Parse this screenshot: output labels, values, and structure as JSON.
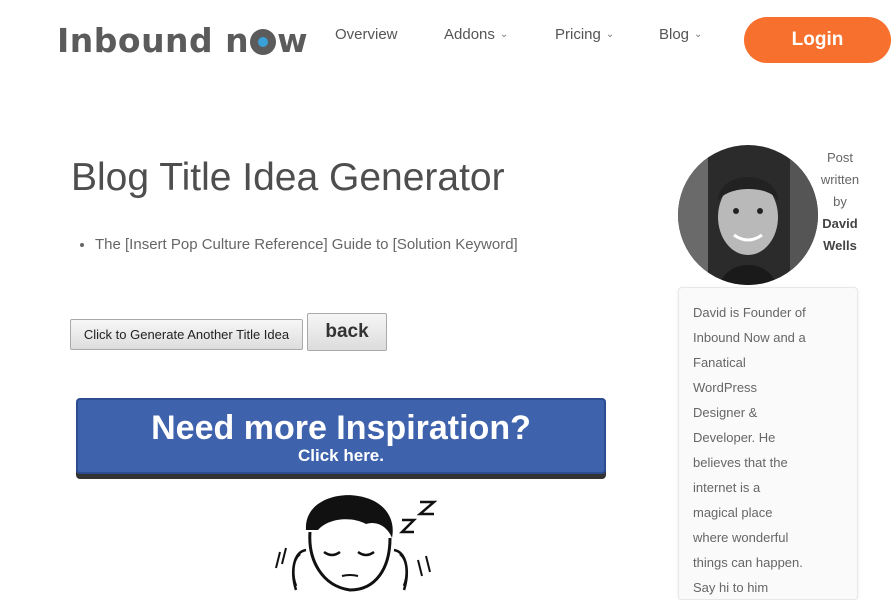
{
  "header": {
    "logo_left": "Inbound n",
    "logo_right": "w",
    "nav": [
      {
        "label": "Overview",
        "has_dropdown": false
      },
      {
        "label": "Addons",
        "has_dropdown": true
      },
      {
        "label": "Pricing",
        "has_dropdown": true
      },
      {
        "label": "Blog",
        "has_dropdown": true
      }
    ],
    "login_label": "Login",
    "accent_color": "#f7702e"
  },
  "main": {
    "title": "Blog Title Idea Generator",
    "ideas": [
      "The [Insert Pop Culture Reference] Guide to [Solution Keyword]"
    ],
    "generate_label": "Click to Generate Another Title Idea",
    "back_label": "back",
    "banner_heading": "Need more Inspiration?",
    "banner_sub": "Click here.",
    "banner_color": "#3f62ad",
    "cartoon_icon": "sleeping-person-illustration"
  },
  "sidebar": {
    "label_lines": [
      "Post",
      "written",
      "by"
    ],
    "author_lines": [
      "David",
      "Wells"
    ],
    "bio_lines": [
      "David is Founder of",
      "Inbound Now and a",
      "Fanatical",
      "WordPress",
      "Designer &",
      "Developer. He",
      "believes that the",
      "internet is a",
      "magical place",
      "where wonderful",
      "things can happen.",
      "Say hi to him"
    ]
  }
}
